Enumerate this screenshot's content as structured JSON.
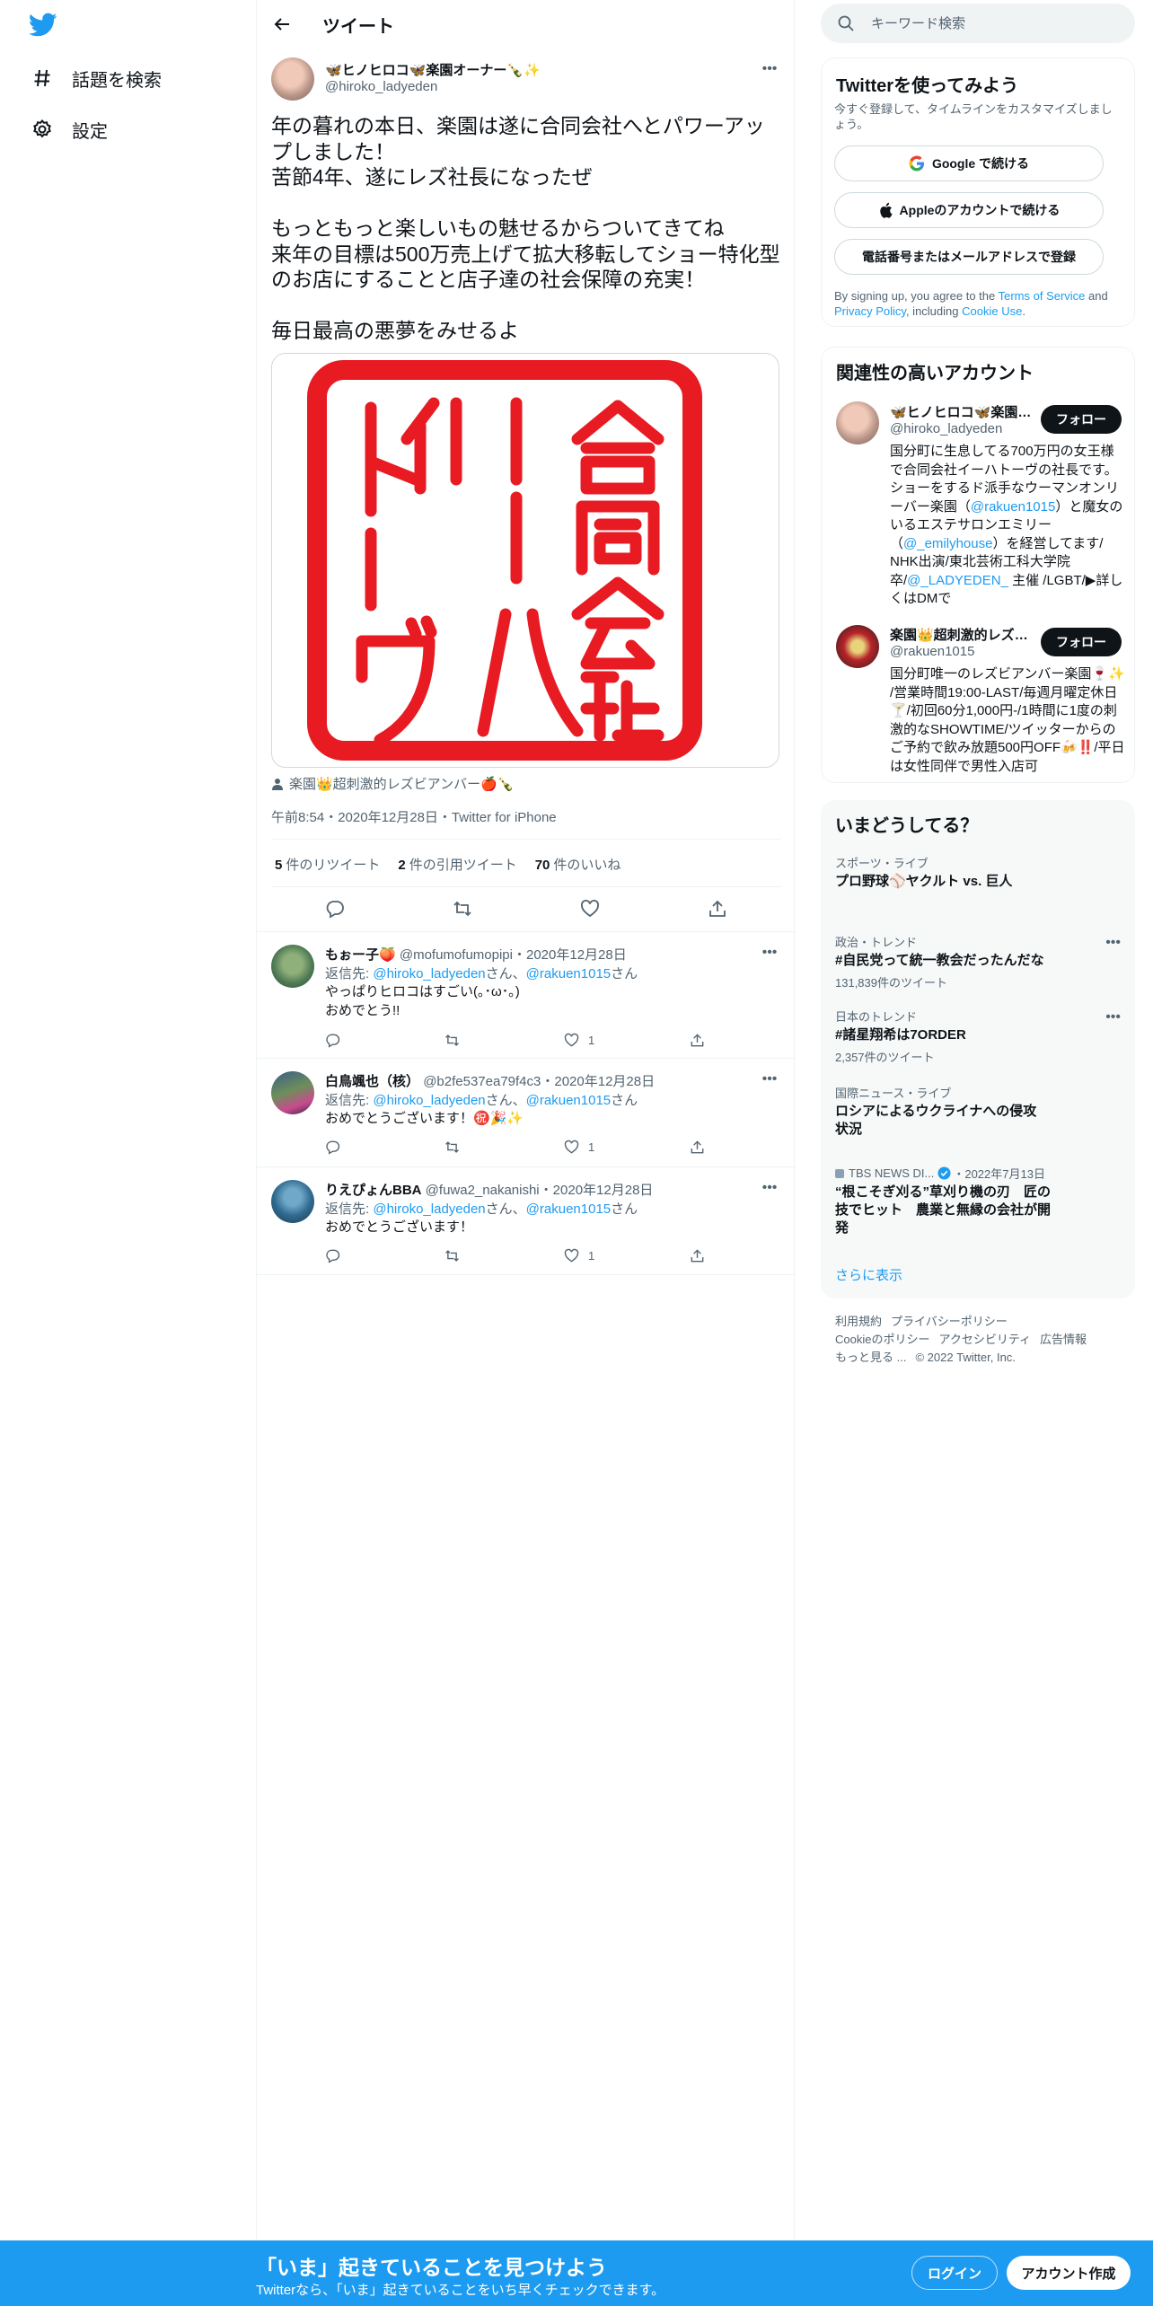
{
  "colors": {
    "accent": "#1d9bf0",
    "text": "#0f1419",
    "muted": "#536471",
    "border": "#eff3f4",
    "stamp_red": "#e81b23"
  },
  "nav": {
    "logo_icon": "twitter-bird-icon",
    "items": [
      {
        "icon": "hashtag-icon",
        "label": "話題を検索"
      },
      {
        "icon": "gear-icon",
        "label": "設定"
      }
    ]
  },
  "header": {
    "title": "ツイート"
  },
  "tweet": {
    "author": {
      "name": "🦋ヒノヒロコ🦋楽園オーナー🍾✨",
      "handle": "@hiroko_ladyeden"
    },
    "text": "年の暮れの本日、楽園は遂に合同会社へとパワーアップしました！\n苦節4年、遂にレズ社長になったぜ\n\nもっともっと楽しいもの魅せるからついてきてね\n来年の目標は500万売上げて拡大移転してショー特化型のお店にすることと店子達の社会保障の充実！\n\n毎日最高の悪夢をみせるよ",
    "image_stamp_text": "合同会社 イーハトーヴ",
    "tagged": "楽園👑超刺激的レズビアンバー🍎🍾",
    "meta": "午前8:54・2020年12月28日・Twitter for iPhone",
    "stats": {
      "retweets": "5",
      "retweets_label": "件のリツイート",
      "quotes": "2",
      "quotes_label": "件の引用ツイート",
      "likes": "70",
      "likes_label": "件のいいね"
    }
  },
  "replies": [
    {
      "name": "もぉー子🍑",
      "handle": "@mofumofumopipi",
      "date": "2020年12月28日",
      "to_prefix": "返信先: ",
      "to1": "@hiroko_ladyeden",
      "to_mid": "さん、",
      "to2": "@rakuen1015",
      "to_suffix": "さん",
      "text": "やっぱりヒロコはすごい(｡･ω･｡)\nおめでとう!!",
      "likes": "1"
    },
    {
      "name": "白鳥颯也（核）",
      "handle": "@b2fe537ea79f4c3",
      "date": "2020年12月28日",
      "to_prefix": "返信先: ",
      "to1": "@hiroko_ladyeden",
      "to_mid": "さん、",
      "to2": "@rakuen1015",
      "to_suffix": "さん",
      "text": "おめでとうございます！㊗️🎉✨",
      "likes": "1"
    },
    {
      "name": "りえぴょんBBA",
      "handle": "@fuwa2_nakanishi",
      "date": "2020年12月28日",
      "to_prefix": "返信先: ",
      "to1": "@hiroko_ladyeden",
      "to_mid": "さん、",
      "to2": "@rakuen1015",
      "to_suffix": "さん",
      "text": "おめでとうございます！",
      "likes": "1"
    }
  ],
  "search": {
    "placeholder": "キーワード検索"
  },
  "signup": {
    "title": "Twitterを使ってみよう",
    "subtitle": "今すぐ登録して、タイムラインをカスタマイズしましょう。",
    "google": "Google で続ける",
    "apple": "Appleのアカウントで続ける",
    "phone": "電話番号またはメールアドレスで登録",
    "terms_pre": "By signing up, you agree to the ",
    "terms_link": "Terms of Service",
    "terms_and": " and ",
    "privacy_link": "Privacy Policy",
    "terms_including": ", including ",
    "cookie_link": "Cookie Use",
    "terms_end": "."
  },
  "related": {
    "title": "関連性の高いアカウント",
    "accounts": [
      {
        "name": "🦋ヒノヒロコ🦋楽園オーナー",
        "handle": "@hiroko_ladyeden",
        "follow": "フォロー",
        "bio_1": "国分町に生息してる700万円の女王様で合同会社イーハトーヴの社長です。ショーをするド派手なウーマンオンリーバー楽園（",
        "bio_link1": "@rakuen1015",
        "bio_2": "）と魔女のいるエステサロンエミリー（",
        "bio_link2": "@_emilyhouse",
        "bio_3": "）を経営してます/ NHK出演/東北芸術工科大学院卒/",
        "bio_link3": "@_LADYEDEN_",
        "bio_4": " 主催 /LGBT/▶詳しくはDMで"
      },
      {
        "name": "楽園👑超刺激的レズビアンバー",
        "handle": "@rakuen1015",
        "follow": "フォロー",
        "bio": "国分町唯一のレズビアンバー楽園🍷✨ /営業時間19:00-LAST/毎週月曜定休日🍸/初回60分1,000円-/1時間に1度の刺激的なSHOWTIME/ツイッターからのご予約で飲み放題500円OFF🍻‼️/平日は女性同伴で男性入店可"
      }
    ]
  },
  "trends": {
    "title": "いまどうしてる？",
    "items": [
      {
        "category": "スポーツ・ライブ",
        "title": "プロ野球⚾ヤクルト vs. 巨人",
        "count": ""
      },
      {
        "category": "政治・トレンド",
        "title": "#自民党って統一教会だったんだな",
        "count": "131,839件のツイート"
      },
      {
        "category": "日本のトレンド",
        "title": "#諸星翔希は7ORDER",
        "count": "2,357件のツイート"
      },
      {
        "category": "国際ニュース・ライブ",
        "title": "ロシアによるウクライナへの侵攻状況",
        "count": ""
      },
      {
        "category": "TBS NEWS DI...",
        "category_date": "・2022年7月13日",
        "title": "“根こそぎ刈る”草刈り機の刃　匠の技でヒット　農業と無縁の会社が開発",
        "count": ""
      }
    ],
    "show_more": "さらに表示"
  },
  "footer": {
    "links": [
      "利用規約",
      "プライバシーポリシー",
      "Cookieのポリシー",
      "アクセシビリティ",
      "広告情報",
      "もっと見る ..."
    ],
    "copyright": "© 2022 Twitter, Inc."
  },
  "bottom_bar": {
    "title": "「いま」起きていることを見つけよう",
    "subtitle": "Twitterなら、「いま」起きていることをいち早くチェックできます。",
    "login": "ログイン",
    "signup": "アカウント作成"
  }
}
